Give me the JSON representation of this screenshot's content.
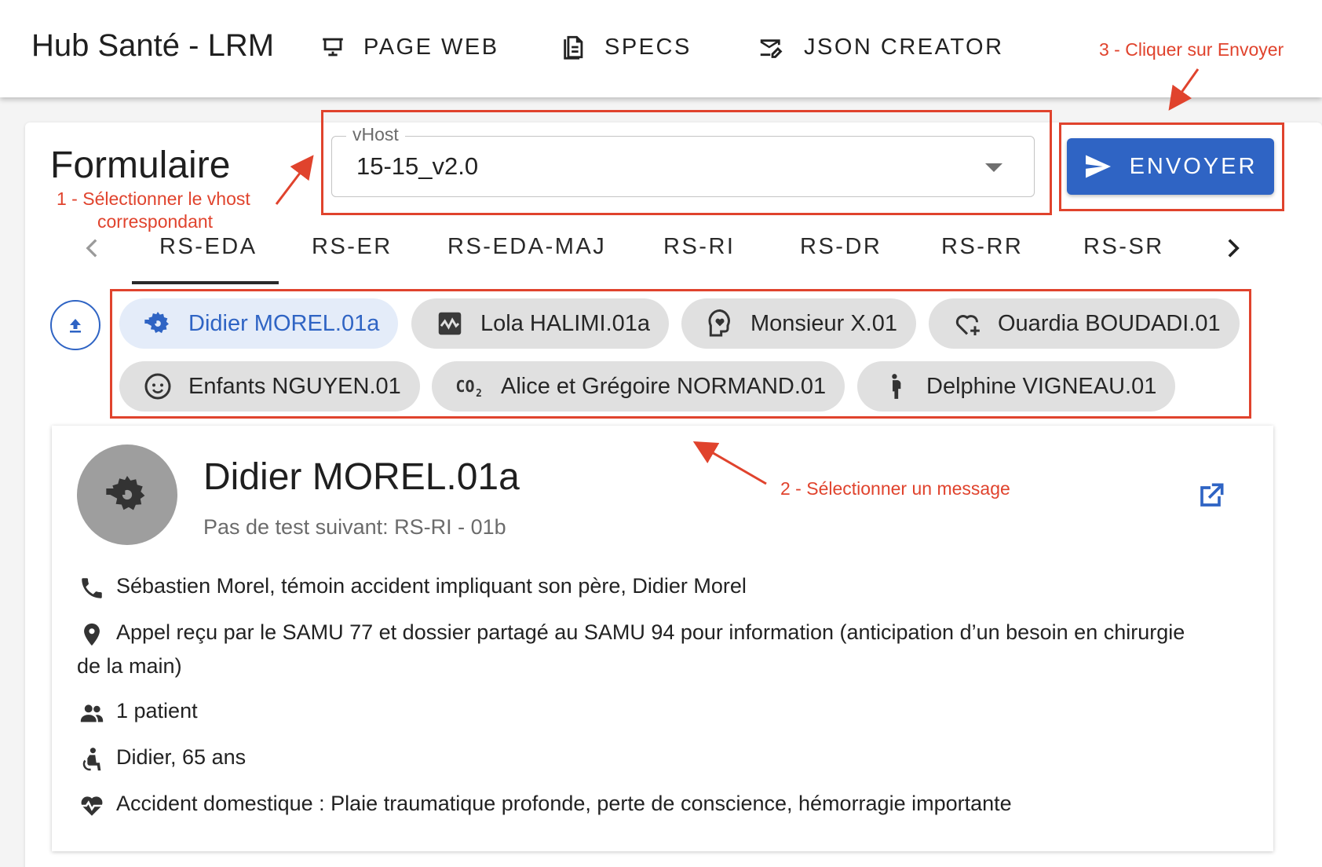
{
  "appbar": {
    "brand": "Hub Santé - LRM",
    "nav": [
      {
        "label": "PAGE WEB",
        "icon": "presentation-icon"
      },
      {
        "label": "SPECS",
        "icon": "document-icon"
      },
      {
        "label": "JSON CREATOR",
        "icon": "mail-edit-icon"
      }
    ]
  },
  "form": {
    "title": "Formulaire",
    "vhost": {
      "label": "vHost",
      "value": "15-15_v2.0"
    },
    "send_label": "ENVOYER"
  },
  "tabs": {
    "items": [
      "RS-EDA",
      "RS-ER",
      "RS-EDA-MAJ",
      "RS-RI",
      "RS-DR",
      "RS-RR",
      "RS-SR"
    ],
    "active_index": 0
  },
  "chips": [
    {
      "label": "Didier MOREL.01a",
      "icon": "saw-blade-icon",
      "selected": true
    },
    {
      "label": "Lola HALIMI.01a",
      "icon": "waveform-icon",
      "selected": false
    },
    {
      "label": "Monsieur X.01",
      "icon": "head-heart-icon",
      "selected": false
    },
    {
      "label": "Ouardia BOUDADI.01",
      "icon": "heart-plus-icon",
      "selected": false
    },
    {
      "label": "Enfants NGUYEN.01",
      "icon": "baby-face-icon",
      "selected": false
    },
    {
      "label": "Alice et Grégoire NORMAND.01",
      "icon": "co2-icon",
      "selected": false
    },
    {
      "label": "Delphine VIGNEAU.01",
      "icon": "pregnant-woman-icon",
      "selected": false
    }
  ],
  "detail": {
    "title": "Didier MOREL.01a",
    "subtitle": "Pas de test suivant: RS-RI - 01b",
    "rows": [
      {
        "icon": "phone-icon",
        "text": "Sébastien Morel, témoin accident impliquant son père, Didier Morel"
      },
      {
        "icon": "location-pin-icon",
        "text": "Appel reçu par le SAMU 77 et dossier partagé au SAMU 94 pour information (anticipation d’un besoin en chirurgie de la main)"
      },
      {
        "icon": "people-icon",
        "text": "1 patient"
      },
      {
        "icon": "seated-person-icon",
        "text": "Didier, 65 ans"
      },
      {
        "icon": "heart-pulse-icon",
        "text": "Accident domestique : Plaie traumatique profonde, perte de conscience, hémorragie importante"
      }
    ]
  },
  "annotations": {
    "step1_line1": "1 - Sélectionner le vhost",
    "step1_line2": "correspondant",
    "step2": "2 - Sélectionner un message",
    "step3": "3 - Cliquer sur Envoyer",
    "color": "#e0432d"
  },
  "colors": {
    "primary": "#2f64c4",
    "chip_bg": "#e0e0e0",
    "chip_selected_bg": "#e4ecf9",
    "avatar_bg": "#9e9e9e"
  }
}
